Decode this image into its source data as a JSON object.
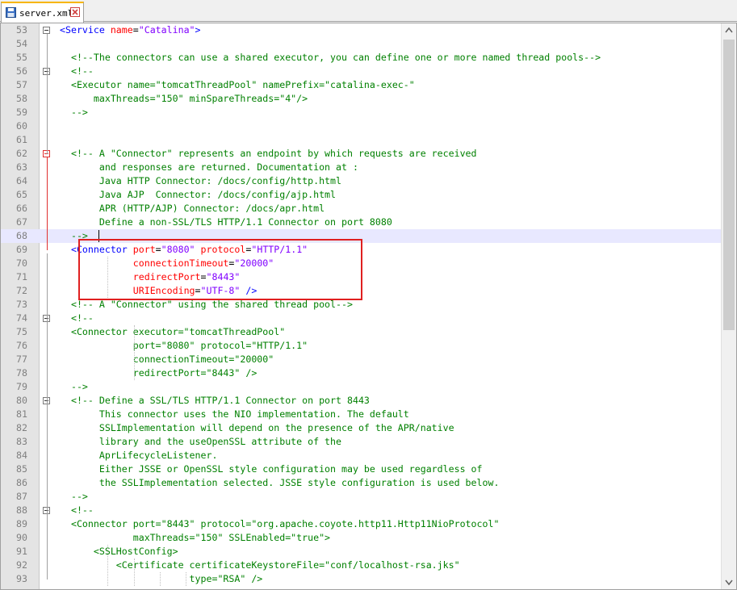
{
  "tab": {
    "title": "server.xml"
  },
  "lines": [
    {
      "n": "53",
      "segs": [
        [
          "tag",
          "<Service "
        ],
        [
          "attr",
          "name"
        ],
        [
          "plain",
          "="
        ],
        [
          "val",
          "\"Catalina\""
        ],
        [
          "tag",
          ">"
        ]
      ],
      "fold": "box"
    },
    {
      "n": "54",
      "segs": []
    },
    {
      "n": "55",
      "segs": [
        [
          "comment",
          "  <!--The connectors can use a shared executor, you can define one or more named thread pools-->"
        ]
      ]
    },
    {
      "n": "56",
      "segs": [
        [
          "comment",
          "  <!--"
        ]
      ],
      "fold": "box"
    },
    {
      "n": "57",
      "segs": [
        [
          "comment",
          "  <Executor name=\"tomcatThreadPool\" namePrefix=\"catalina-exec-\""
        ]
      ]
    },
    {
      "n": "58",
      "segs": [
        [
          "comment",
          "      maxThreads=\"150\" minSpareThreads=\"4\"/>"
        ]
      ]
    },
    {
      "n": "59",
      "segs": [
        [
          "comment",
          "  -->"
        ]
      ]
    },
    {
      "n": "60",
      "segs": []
    },
    {
      "n": "61",
      "segs": []
    },
    {
      "n": "62",
      "segs": [
        [
          "comment",
          "  <!-- A \"Connector\" represents an endpoint by which requests are received"
        ]
      ],
      "fold": "boxred"
    },
    {
      "n": "63",
      "segs": [
        [
          "comment",
          "       and responses are returned. Documentation at :"
        ]
      ]
    },
    {
      "n": "64",
      "segs": [
        [
          "comment",
          "       Java HTTP Connector: /docs/config/http.html"
        ]
      ]
    },
    {
      "n": "65",
      "segs": [
        [
          "comment",
          "       Java AJP  Connector: /docs/config/ajp.html"
        ]
      ]
    },
    {
      "n": "66",
      "segs": [
        [
          "comment",
          "       APR (HTTP/AJP) Connector: /docs/apr.html"
        ]
      ]
    },
    {
      "n": "67",
      "segs": [
        [
          "comment",
          "       Define a non-SSL/TLS HTTP/1.1 Connector on port 8080"
        ]
      ]
    },
    {
      "n": "68",
      "segs": [
        [
          "comment",
          "  -->"
        ]
      ],
      "current": true
    },
    {
      "n": "69",
      "segs": [
        [
          "tag",
          "  <Connector "
        ],
        [
          "attr",
          "port"
        ],
        [
          "plain",
          "="
        ],
        [
          "val",
          "\"8080\""
        ],
        [
          "plain",
          " "
        ],
        [
          "attr",
          "protocol"
        ],
        [
          "plain",
          "="
        ],
        [
          "val",
          "\"HTTP/1.1\""
        ]
      ]
    },
    {
      "n": "70",
      "segs": [
        [
          "plain",
          "             "
        ],
        [
          "attr",
          "connectionTimeout"
        ],
        [
          "plain",
          "="
        ],
        [
          "val",
          "\"20000\""
        ]
      ]
    },
    {
      "n": "71",
      "segs": [
        [
          "plain",
          "             "
        ],
        [
          "attr",
          "redirectPort"
        ],
        [
          "plain",
          "="
        ],
        [
          "val",
          "\"8443\""
        ]
      ]
    },
    {
      "n": "72",
      "segs": [
        [
          "plain",
          "             "
        ],
        [
          "attr",
          "URIEncoding"
        ],
        [
          "plain",
          "="
        ],
        [
          "val",
          "\"UTF-8\""
        ],
        [
          "plain",
          " "
        ],
        [
          "tag",
          "/>"
        ]
      ]
    },
    {
      "n": "73",
      "segs": [
        [
          "comment",
          "  <!-- A \"Connector\" using the shared thread pool-->"
        ]
      ]
    },
    {
      "n": "74",
      "segs": [
        [
          "comment",
          "  <!--"
        ]
      ],
      "fold": "box"
    },
    {
      "n": "75",
      "segs": [
        [
          "comment",
          "  <Connector executor=\"tomcatThreadPool\""
        ]
      ]
    },
    {
      "n": "76",
      "segs": [
        [
          "comment",
          "             port=\"8080\" protocol=\"HTTP/1.1\""
        ]
      ]
    },
    {
      "n": "77",
      "segs": [
        [
          "comment",
          "             connectionTimeout=\"20000\""
        ]
      ]
    },
    {
      "n": "78",
      "segs": [
        [
          "comment",
          "             redirectPort=\"8443\" />"
        ]
      ]
    },
    {
      "n": "79",
      "segs": [
        [
          "comment",
          "  -->"
        ]
      ]
    },
    {
      "n": "80",
      "segs": [
        [
          "comment",
          "  <!-- Define a SSL/TLS HTTP/1.1 Connector on port 8443"
        ]
      ],
      "fold": "box"
    },
    {
      "n": "81",
      "segs": [
        [
          "comment",
          "       This connector uses the NIO implementation. The default"
        ]
      ]
    },
    {
      "n": "82",
      "segs": [
        [
          "comment",
          "       SSLImplementation will depend on the presence of the APR/native"
        ]
      ]
    },
    {
      "n": "83",
      "segs": [
        [
          "comment",
          "       library and the useOpenSSL attribute of the"
        ]
      ]
    },
    {
      "n": "84",
      "segs": [
        [
          "comment",
          "       AprLifecycleListener."
        ]
      ]
    },
    {
      "n": "85",
      "segs": [
        [
          "comment",
          "       Either JSSE or OpenSSL style configuration may be used regardless of"
        ]
      ]
    },
    {
      "n": "86",
      "segs": [
        [
          "comment",
          "       the SSLImplementation selected. JSSE style configuration is used below."
        ]
      ]
    },
    {
      "n": "87",
      "segs": [
        [
          "comment",
          "  -->"
        ]
      ]
    },
    {
      "n": "88",
      "segs": [
        [
          "comment",
          "  <!--"
        ]
      ],
      "fold": "box"
    },
    {
      "n": "89",
      "segs": [
        [
          "comment",
          "  <Connector port=\"8443\" protocol=\"org.apache.coyote.http11.Http11NioProtocol\""
        ]
      ]
    },
    {
      "n": "90",
      "segs": [
        [
          "comment",
          "             maxThreads=\"150\" SSLEnabled=\"true\">"
        ]
      ]
    },
    {
      "n": "91",
      "segs": [
        [
          "comment",
          "      <SSLHostConfig>"
        ]
      ]
    },
    {
      "n": "92",
      "segs": [
        [
          "comment",
          "          <Certificate certificateKeystoreFile=\"conf/localhost-rsa.jks\""
        ]
      ]
    },
    {
      "n": "93",
      "segs": [
        [
          "comment",
          "                       type=\"RSA\" />"
        ]
      ]
    }
  ],
  "colors": {
    "comment": "#008000",
    "tag": "#0000ff",
    "attr": "#ff0000",
    "val": "#8000ff",
    "highlight": "#e02020"
  },
  "icons": {
    "tab_file": "save-disk-icon",
    "tab_close": "close-icon"
  }
}
